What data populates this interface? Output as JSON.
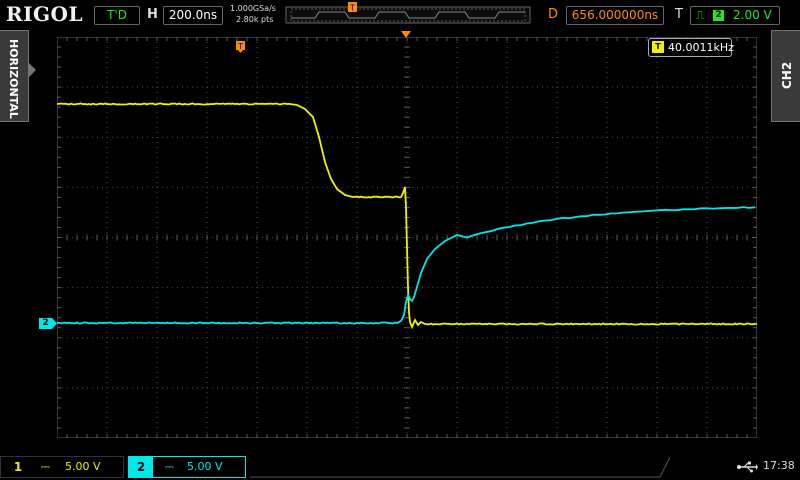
{
  "brand": "RIGOL",
  "top": {
    "run_state": "T'D",
    "h_label": "H",
    "timebase": "200.0ns",
    "sample_rate": "1.000GSa/s",
    "memory_depth": "2.80k pts",
    "d_label": "D",
    "delay": "656.000000ns",
    "t_label": "T",
    "trigger_level": "2.00 V",
    "trigger_source_badge": "2"
  },
  "side": {
    "left_tab": "HORIZONTAL",
    "right_tab": "CH2"
  },
  "measurement": {
    "frequency": "40.0011kHz"
  },
  "channels": [
    {
      "number": "1",
      "coupling": "⎓",
      "scale": "5.00 V",
      "color": "#f0f000"
    },
    {
      "number": "2",
      "coupling": "⎓",
      "scale": "5.00 V",
      "color": "#00e8e8"
    }
  ],
  "ch2_ground_marker": "2",
  "clock": "17:38",
  "colors": {
    "ch1": "#f0f000",
    "ch2": "#00e8e8",
    "trigger": "#ff8c00",
    "grid": "#5a5a5a"
  }
}
